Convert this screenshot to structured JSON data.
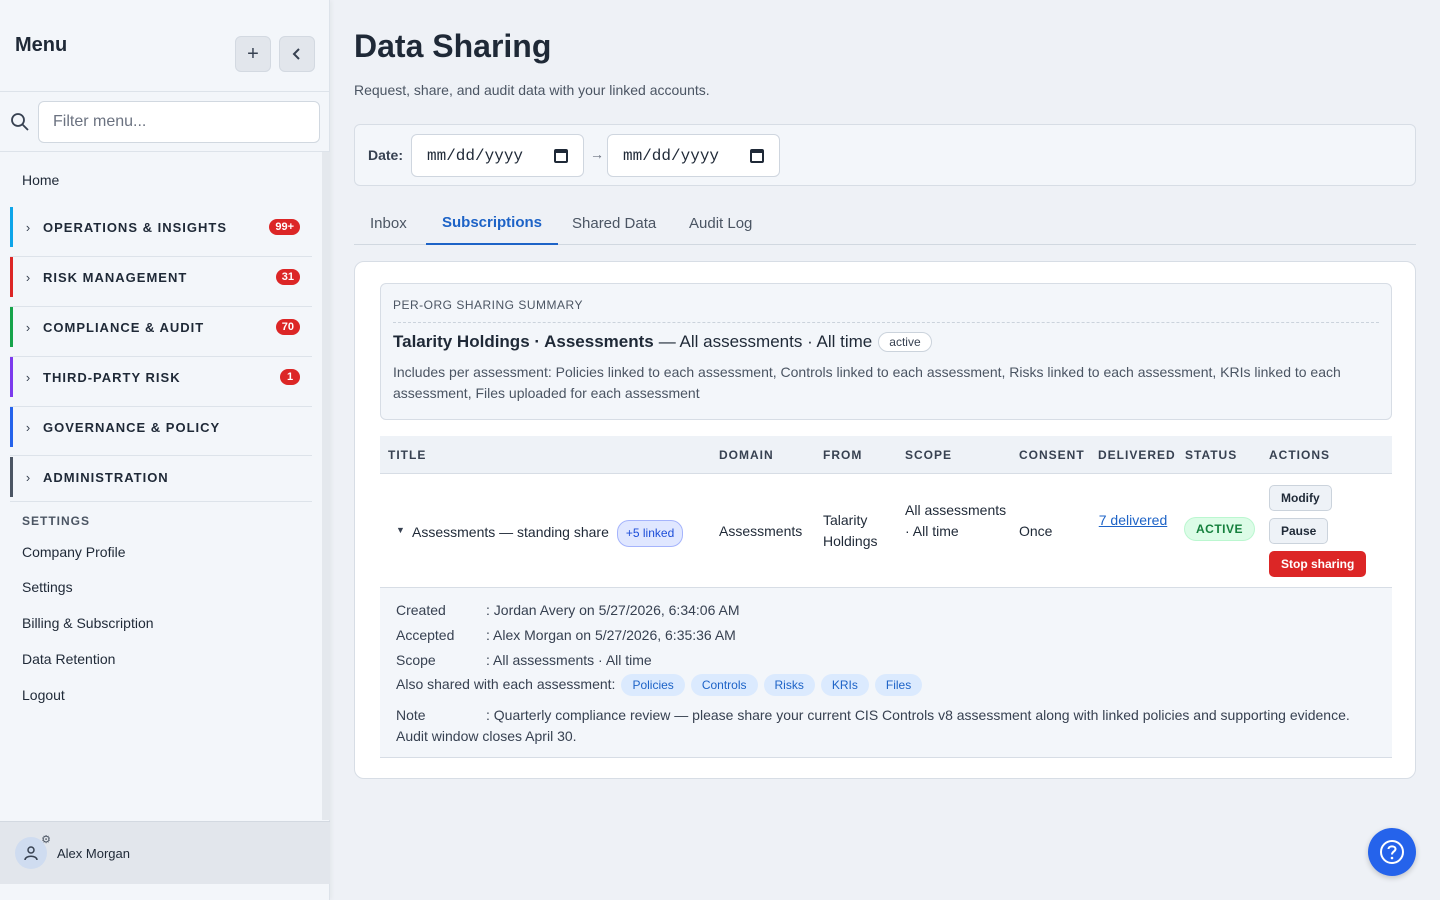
{
  "sidebar": {
    "title": "Menu",
    "filter_placeholder": "Filter menu...",
    "home": "Home",
    "groups": [
      {
        "label": "OPERATIONS & INSIGHTS",
        "badge": "99+",
        "color": "#0ea5e9"
      },
      {
        "label": "RISK MANAGEMENT",
        "badge": "31",
        "color": "#dc2626"
      },
      {
        "label": "COMPLIANCE & AUDIT",
        "badge": "70",
        "color": "#16a34a"
      },
      {
        "label": "THIRD-PARTY RISK",
        "badge": "1",
        "color": "#7c3aed"
      },
      {
        "label": "GOVERNANCE & POLICY",
        "badge": "",
        "color": "#2563eb"
      },
      {
        "label": "ADMINISTRATION",
        "badge": "",
        "color": "#4b5563"
      }
    ],
    "settings_heading": "SETTINGS",
    "settings_links": [
      "Company Profile",
      "Settings",
      "Billing & Subscription",
      "Data Retention",
      "Logout"
    ],
    "user_name": "Alex Morgan"
  },
  "page": {
    "title": "Data Sharing",
    "subtitle": "Request, share, and audit data with your linked accounts."
  },
  "filter": {
    "date_label": "Date:",
    "from_placeholder": "mm/dd/yyyy",
    "arrow": "→",
    "to_placeholder": "mm/dd/yyyy"
  },
  "tabs": [
    {
      "label": "Inbox",
      "active": false
    },
    {
      "label": "Subscriptions",
      "active": true
    },
    {
      "label": "Shared Data",
      "active": false
    },
    {
      "label": "Audit Log",
      "active": false
    }
  ],
  "summary": {
    "heading": "PER-ORG SHARING SUMMARY",
    "org_domain": "Talarity Holdings · Assessments",
    "scope": "— All assessments · All time",
    "state": "active",
    "description": "Includes per assessment: Policies linked to each assessment, Controls linked to each assessment, Risks linked to each assessment, KRIs linked to each assessment, Files uploaded for each assessment"
  },
  "table": {
    "headers": [
      "TITLE",
      "DOMAIN",
      "FROM",
      "SCOPE",
      "CONSENT",
      "DELIVERED",
      "STATUS",
      "ACTIONS"
    ],
    "row": {
      "title": "Assessments — standing share",
      "linked": "+5 linked",
      "domain": "Assessments",
      "from": "Talarity Holdings",
      "scope": "All assessments · All time",
      "consent": "Once",
      "delivered": "7 delivered",
      "status": "ACTIVE",
      "actions": {
        "modify": "Modify",
        "pause": "Pause",
        "stop": "Stop sharing"
      }
    }
  },
  "detail": {
    "created_label": "Created",
    "created_value": ": Jordan Avery on 5/27/2026, 6:34:06 AM",
    "accepted_label": "Accepted",
    "accepted_value": ": Alex Morgan on 5/27/2026, 6:35:36 AM",
    "scope_label": "Scope",
    "scope_value": ": All assessments · All time",
    "also_label": "Also shared with each assessment:",
    "chips": [
      "Policies",
      "Controls",
      "Risks",
      "KRIs",
      "Files"
    ],
    "note_label": "Note",
    "note_value": ": Quarterly compliance review — please share your current CIS Controls v8 assessment along with linked policies and supporting evidence. Audit window closes April 30."
  },
  "icons": {
    "add": "plus-icon",
    "collapse": "chevron-left-icon",
    "search": "search-icon",
    "calendar": "calendar-icon",
    "help": "question-circle-icon",
    "user": "user-icon",
    "gear": "gear-icon"
  }
}
